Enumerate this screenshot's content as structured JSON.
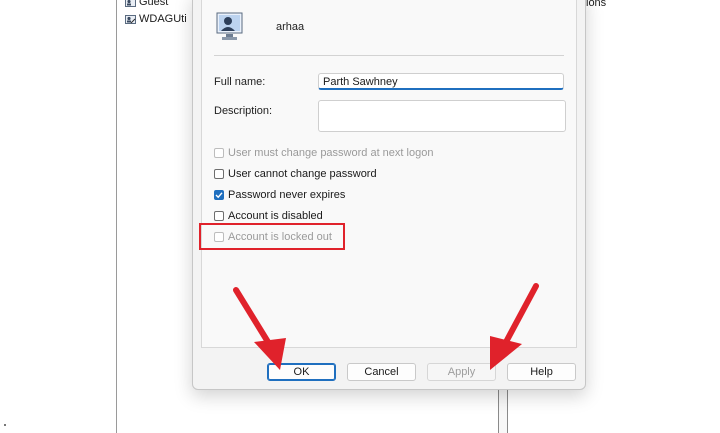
{
  "background": {
    "users": [
      {
        "label": "Guest"
      },
      {
        "label": "WDAGUti"
      }
    ],
    "right_text": "ions"
  },
  "dialog": {
    "username": "arhaa",
    "full_name_label": "Full name:",
    "full_name_value": "Parth Sawhney",
    "description_label": "Description:",
    "description_value": "",
    "checkboxes": [
      {
        "label": "User must change password at next logon",
        "checked": false,
        "disabled": true
      },
      {
        "label": "User cannot change password",
        "checked": false,
        "disabled": false
      },
      {
        "label": "Password never expires",
        "checked": true,
        "disabled": false
      },
      {
        "label": "Account is disabled",
        "checked": false,
        "disabled": false
      },
      {
        "label": "Account is locked out",
        "checked": false,
        "disabled": true
      }
    ],
    "buttons": {
      "ok": "OK",
      "cancel": "Cancel",
      "apply": "Apply",
      "help": "Help"
    }
  },
  "colors": {
    "accent": "#1f6fbf",
    "annotation_red": "#e0222b"
  }
}
